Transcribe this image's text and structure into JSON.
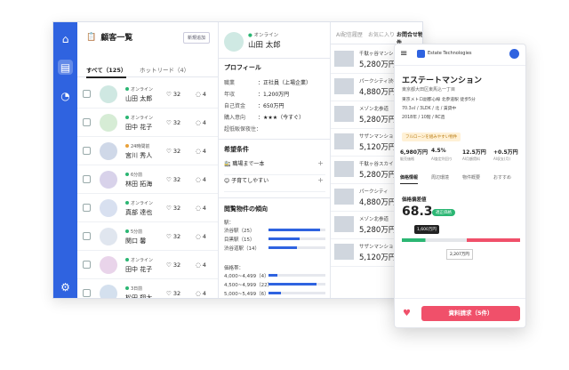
{
  "list": {
    "title": "顧客一覧",
    "add_button": "新規追加",
    "tab_all": "すべて（125）",
    "tab_hot": "ホットリード（4）",
    "rows": [
      {
        "status": "オンライン",
        "name": "山田 太郎",
        "likes": "32",
        "msgs": "4",
        "av": "#cfe8e2",
        "dot": "#2bb673"
      },
      {
        "status": "オンライン",
        "name": "田中 花子",
        "likes": "32",
        "msgs": "4",
        "av": "#d6ecd5",
        "dot": "#2bb673"
      },
      {
        "status": "24時間前",
        "name": "宮川 秀人",
        "likes": "32",
        "msgs": "4",
        "av": "#cfd8e8",
        "dot": "#e9a23b"
      },
      {
        "status": "6分前",
        "name": "林田 拓海",
        "likes": "32",
        "msgs": "4",
        "av": "#d8d2ea",
        "dot": "#2bb673"
      },
      {
        "status": "オンライン",
        "name": "真部 達也",
        "likes": "32",
        "msgs": "4",
        "av": "#d8e0f0",
        "dot": "#2bb673"
      },
      {
        "status": "5分前",
        "name": "関口 馨",
        "likes": "32",
        "msgs": "4",
        "av": "#e0e6ef",
        "dot": "#2bb673"
      },
      {
        "status": "オンライン",
        "name": "田中 花子",
        "likes": "32",
        "msgs": "4",
        "av": "#e9d4ea",
        "dot": "#2bb673"
      },
      {
        "status": "3日前",
        "name": "松田 翔太",
        "likes": "32",
        "msgs": "4",
        "av": "#d4e0ee",
        "dot": "#2bb673"
      }
    ]
  },
  "detail": {
    "status": "オンライン",
    "name": "山田 太郎",
    "profile_title": "プロフィール",
    "profile": [
      {
        "k": "職業",
        "v": "：正社員（上場企業）"
      },
      {
        "k": "年収",
        "v": "：1,200万円"
      },
      {
        "k": "自己資金",
        "v": "：650万円"
      },
      {
        "k": "購入意向",
        "v": "：★★★（今すぐ）"
      },
      {
        "k": "超低販保夜住：",
        "v": ""
      }
    ],
    "wish_title": "希望条件",
    "wish": [
      "🚉 職場まで一本",
      "😊 子育てしやすい"
    ],
    "trend_title": "閲覧物件の傾向",
    "station_label": "駅：",
    "stations": [
      {
        "n": "渋谷駅（25）",
        "v": 0.9
      },
      {
        "n": "目黒駅（15）",
        "v": 0.55
      },
      {
        "n": "渋谷道駅（14）",
        "v": 0.5
      }
    ],
    "price_label": "価格帯：",
    "prices": [
      {
        "n": "4,000~4,499（4）",
        "v": 0.15
      },
      {
        "n": "4,500~4,999（22）",
        "v": 0.85
      },
      {
        "n": "5,000~5,499（6）",
        "v": 0.22
      }
    ]
  },
  "props": {
    "tabs": [
      "AI配信履歴",
      "お気に入り",
      "お問合せ物件"
    ],
    "rows": [
      {
        "t": "千駄ヶ谷マンション",
        "p": "5,280万円"
      },
      {
        "t": "パークシティ渋谷",
        "p": "4,880万円"
      },
      {
        "t": "メゾン北参道",
        "p": "5,280万円"
      },
      {
        "t": "サザンマンション",
        "p": "5,120万円"
      },
      {
        "t": "千駄ヶ谷スカイ",
        "p": "5,280万円"
      },
      {
        "t": "パークシティ",
        "p": "4,880万円"
      },
      {
        "t": "メゾン北参道",
        "p": "5,280万円"
      },
      {
        "t": "サザンマンション",
        "p": "5,120万円"
      }
    ]
  },
  "mobile": {
    "brand": "Estate Technologies",
    "title": "エステートマンション",
    "addr": "東京都大田区東馬込一丁目",
    "info": [
      "東京メトロ副都心線 北参道駅 徒歩5分",
      "70.3㎡ / 3LDK / 北 / 賃貸中",
      "2018年 / 10階 / RC造"
    ],
    "tag": "フルローンを組みやすい物件",
    "stats": [
      {
        "v": "6,980万円",
        "l": "販売価格"
      },
      {
        "v": "4.5%",
        "l": "AI査定利回り"
      },
      {
        "v": "12.5万円",
        "l": "AI月額賃料"
      },
      {
        "v": "+0.5万円",
        "l": "AI収支(月)"
      }
    ],
    "tabs": [
      "価格情報",
      "周辺環境",
      "物件概要",
      "おすすめ"
    ],
    "score_label": "価格偏差値",
    "score": "68.3",
    "score_badge": "適正価格",
    "p1": "1,600万円",
    "p2": "2,207万円",
    "cta": "資料請求（5件）"
  }
}
